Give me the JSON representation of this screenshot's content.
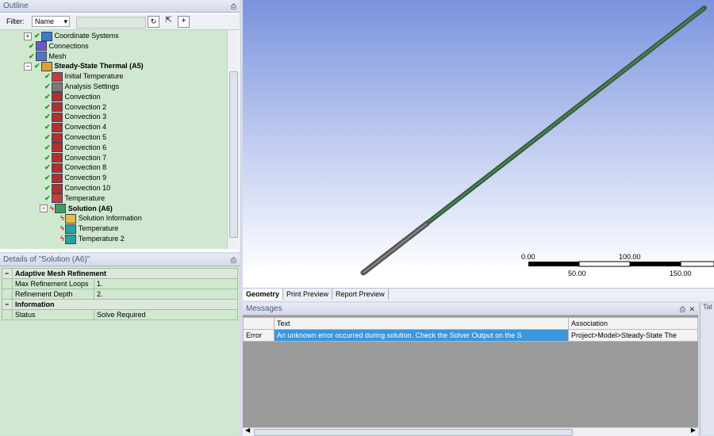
{
  "outline": {
    "title": "Outline",
    "pin": "↕",
    "filter_label": "Filter:",
    "filter_value": "Name",
    "tree": [
      {
        "label": "Coordinate Systems",
        "icon": "coordinate-systems-icon",
        "status": "check",
        "expander": "+"
      },
      {
        "label": "Connections",
        "icon": "connections-icon",
        "status": "check"
      },
      {
        "label": "Mesh",
        "icon": "mesh-icon",
        "status": "check"
      },
      {
        "label": "Steady-State Thermal (A5)",
        "icon": "thermal-analysis-icon",
        "status": "check",
        "expander": "−",
        "bold": true
      },
      {
        "label": "Initial Temperature",
        "icon": "temperature-icon",
        "status": "check"
      },
      {
        "label": "Analysis Settings",
        "icon": "analysis-settings-icon",
        "status": "check"
      },
      {
        "label": "Convection",
        "icon": "convection-icon",
        "status": "check"
      },
      {
        "label": "Convection 2",
        "icon": "convection-icon",
        "status": "check"
      },
      {
        "label": "Convection 3",
        "icon": "convection-icon",
        "status": "check"
      },
      {
        "label": "Convection 4",
        "icon": "convection-icon",
        "status": "check"
      },
      {
        "label": "Convection 5",
        "icon": "convection-icon",
        "status": "check"
      },
      {
        "label": "Convection 6",
        "icon": "convection-icon",
        "status": "check"
      },
      {
        "label": "Convection 7",
        "icon": "convection-icon",
        "status": "check"
      },
      {
        "label": "Convection 8",
        "icon": "convection-icon",
        "status": "check"
      },
      {
        "label": "Convection 9",
        "icon": "convection-icon",
        "status": "check"
      },
      {
        "label": "Convection 10",
        "icon": "convection-icon",
        "status": "check"
      },
      {
        "label": "Temperature",
        "icon": "temperature-icon",
        "status": "check"
      },
      {
        "label": "Solution (A6)",
        "icon": "solution-icon",
        "status": "bolt",
        "expander": "−",
        "bold": true
      },
      {
        "label": "Solution Information",
        "icon": "solution-information-icon",
        "status": "bolt"
      },
      {
        "label": "Temperature",
        "icon": "temperature-result-icon",
        "status": "bolt"
      },
      {
        "label": "Temperature 2",
        "icon": "temperature-result-icon",
        "status": "bolt"
      }
    ]
  },
  "details": {
    "title": "Details of \"Solution (A6)\"",
    "groups": [
      {
        "name": "Adaptive Mesh Refinement",
        "rows": [
          {
            "key": "Max Refinement Loops",
            "value": "1."
          },
          {
            "key": "Refinement Depth",
            "value": "2."
          }
        ]
      },
      {
        "name": "Information",
        "rows": [
          {
            "key": "Status",
            "value": "Solve Required"
          }
        ]
      }
    ]
  },
  "viewport": {
    "scale_labels_top": [
      "0.00",
      "100.00"
    ],
    "scale_labels_bottom": [
      "50.00",
      "150.00"
    ],
    "tabs": [
      "Geometry",
      "Print Preview",
      "Report Preview"
    ]
  },
  "messages": {
    "title": "Messages",
    "columns": [
      "",
      "Text",
      "Association"
    ],
    "rows": [
      {
        "type": "Error",
        "text": "An unknown error occurred during solution.  Check the Solver Output on the S",
        "association": "Project>Model>Steady-State The"
      }
    ]
  },
  "side_panel": {
    "label": "Tal"
  },
  "colors": {
    "tree_bg": "#cfe8cf",
    "viewport_top": "#7b93de",
    "selection": "#3a96dd"
  }
}
